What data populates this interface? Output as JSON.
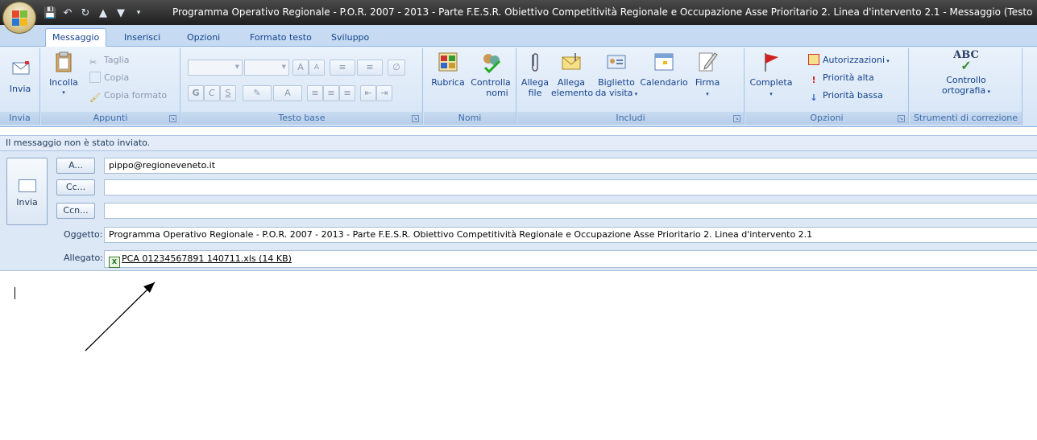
{
  "window": {
    "title": "Programma Operativo Regionale - P.O.R. 2007 - 2013 - Parte F.E.S.R. Obiettivo Competitività Regionale e Occupazione Asse Prioritario 2. Linea d'intervento 2.1  - Messaggio (Testo nor..."
  },
  "tabs": [
    {
      "label": "Messaggio"
    },
    {
      "label": "Inserisci"
    },
    {
      "label": "Opzioni"
    },
    {
      "label": "Formato testo"
    },
    {
      "label": "Sviluppo"
    }
  ],
  "ribbon": {
    "invia_group": {
      "button": "Invia",
      "label": "Invia"
    },
    "appunti": {
      "paste": "Incolla",
      "cut": "Taglia",
      "copy": "Copia",
      "format_painter": "Copia formato",
      "label": "Appunti"
    },
    "testo_base": {
      "bold": "G",
      "italic": "C",
      "underline": "S",
      "grow": "A",
      "shrink": "A",
      "label": "Testo base"
    },
    "nomi": {
      "rubrica": "Rubrica",
      "controlla": "Controlla",
      "controlla2": "nomi",
      "label": "Nomi"
    },
    "includi": {
      "allega_file_1": "Allega",
      "allega_file_2": "file",
      "allega_elem_1": "Allega",
      "allega_elem_2": "elemento",
      "biglietto_1": "Biglietto",
      "biglietto_2": "da visita",
      "calendario": "Calendario",
      "firma": "Firma",
      "label": "Includi"
    },
    "opzioni": {
      "completa": "Completa",
      "autorizzazioni": "Autorizzazioni",
      "priorita_alta": "Priorità alta",
      "priorita_bassa": "Priorità bassa",
      "label": "Opzioni"
    },
    "strumenti": {
      "abc": "ABC",
      "controllo_1": "Controllo",
      "controllo_2": "ortografia",
      "label": "Strumenti di correzione"
    }
  },
  "infobar": {
    "text": "Il messaggio non è stato inviato."
  },
  "compose": {
    "send_label": "Invia",
    "to_button": "A...",
    "to_value": "pippo@regioneveneto.it",
    "cc_button": "Cc...",
    "cc_value": "",
    "bcc_button": "Ccn...",
    "bcc_value": "",
    "subject_label": "Oggetto:",
    "subject_value": "Programma Operativo Regionale - P.O.R. 2007 - 2013 - Parte F.E.S.R. Obiettivo Competitività Regionale e Occupazione Asse Prioritario 2. Linea d'intervento 2.1",
    "attachment_label": "Allegato:",
    "attachment_name": "PCA 01234567891 140711.xls (14 KB)"
  },
  "colors": {
    "ribbon_blue": "#c6dbf2",
    "titlebar": "#2b2b2b",
    "accent": "#15428b"
  }
}
